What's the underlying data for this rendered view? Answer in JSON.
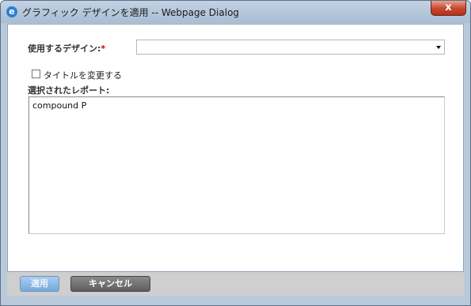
{
  "window": {
    "title": "グラフィック デザインを適用 -- Webpage Dialog",
    "close_label": "x",
    "app_icon": "ie-icon"
  },
  "form": {
    "design_label": "使用するデザイン:",
    "required_mark": "*",
    "design_select": {
      "value": ""
    },
    "change_title_label": "タイトルを変更する",
    "change_title_checked": false,
    "selected_reports_label": "選択されたレポート:",
    "selected_reports": [
      "compound P"
    ]
  },
  "footer": {
    "apply_label": "適用",
    "apply_enabled": false,
    "cancel_label": "キャンセル"
  },
  "colors": {
    "required": "#cc0000",
    "apply_button": "#75a8db",
    "cancel_button": "#5e5e5e",
    "close_button": "#c7452d"
  }
}
